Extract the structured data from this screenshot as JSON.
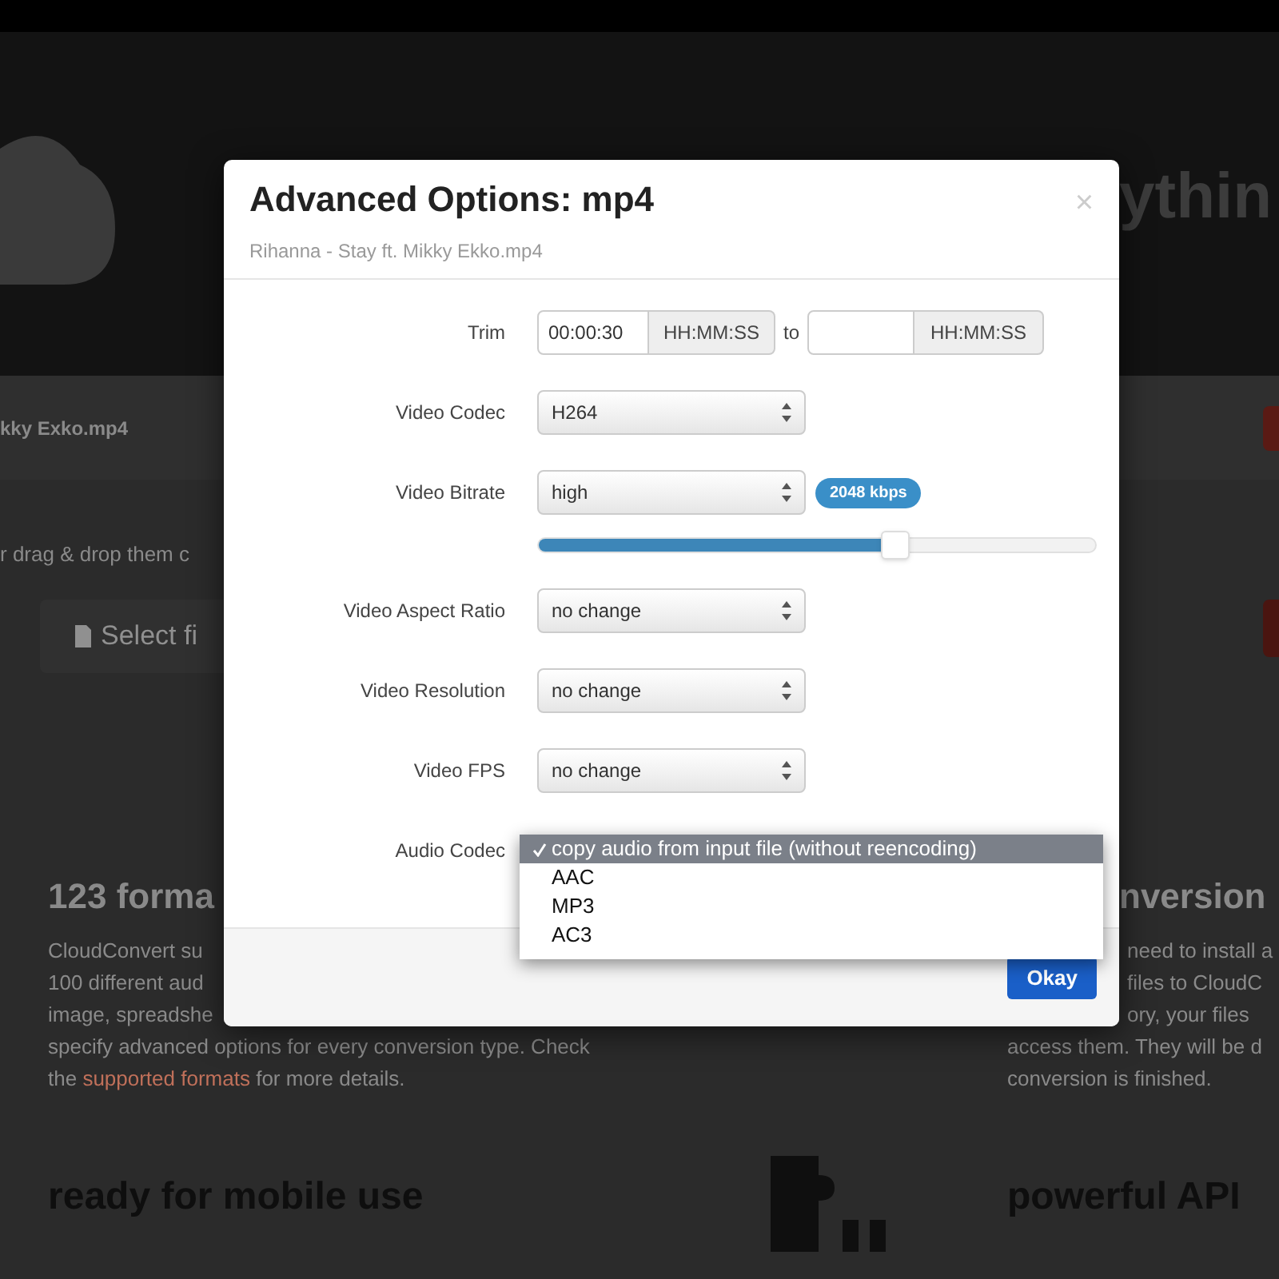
{
  "page": {
    "heading_fragment": "ythin",
    "file_name": "kky Exko.mp4",
    "drop_hint": "r drag & drop them c",
    "select_button": "Select fi",
    "left_feature": {
      "title": "123 forma",
      "lines": [
        "CloudConvert su",
        "100 different aud",
        "image, spreadshe",
        "specify advanced options for every conversion type. Check"
      ],
      "last_line": {
        "before": "the ",
        "link": "supported formats",
        "after": " for more details."
      }
    },
    "right_feature": {
      "title": "nversion",
      "lines": [
        "need to install a",
        "files to CloudC",
        "ory, your files",
        "access them. They will be d",
        "conversion is finished."
      ]
    },
    "bottom_titles": [
      "ready for mobile use",
      "powerful API"
    ]
  },
  "dialog": {
    "title": "Advanced Options: mp4",
    "subtitle": "Rihanna - Stay ft. Mikky Ekko.mp4",
    "close": "×",
    "trim": {
      "label": "Trim",
      "from": "00:00:30",
      "unit": "HH:MM:SS",
      "to_label": "to",
      "to_unit": "HH:MM:SS"
    },
    "fields": [
      {
        "kind": "select",
        "label": "Video Codec",
        "value": "H264"
      },
      {
        "kind": "select",
        "label": "Video Bitrate",
        "value": "high",
        "badge": "2048 kbps",
        "level": 0.64
      },
      {
        "kind": "select",
        "label": "Video Aspect Ratio",
        "value": "no change"
      },
      {
        "kind": "select",
        "label": "Video Resolution",
        "value": "no change"
      },
      {
        "kind": "select",
        "label": "Video FPS",
        "value": "no change"
      },
      {
        "kind": "dropdown",
        "label": "Audio Codec",
        "options": [
          {
            "label": "copy audio from input file (without reencoding)",
            "selected": true
          },
          {
            "label": "AAC",
            "selected": false
          },
          {
            "label": "MP3",
            "selected": false
          },
          {
            "label": "AC3",
            "selected": false
          }
        ]
      }
    ],
    "ok_button": "Okay"
  }
}
